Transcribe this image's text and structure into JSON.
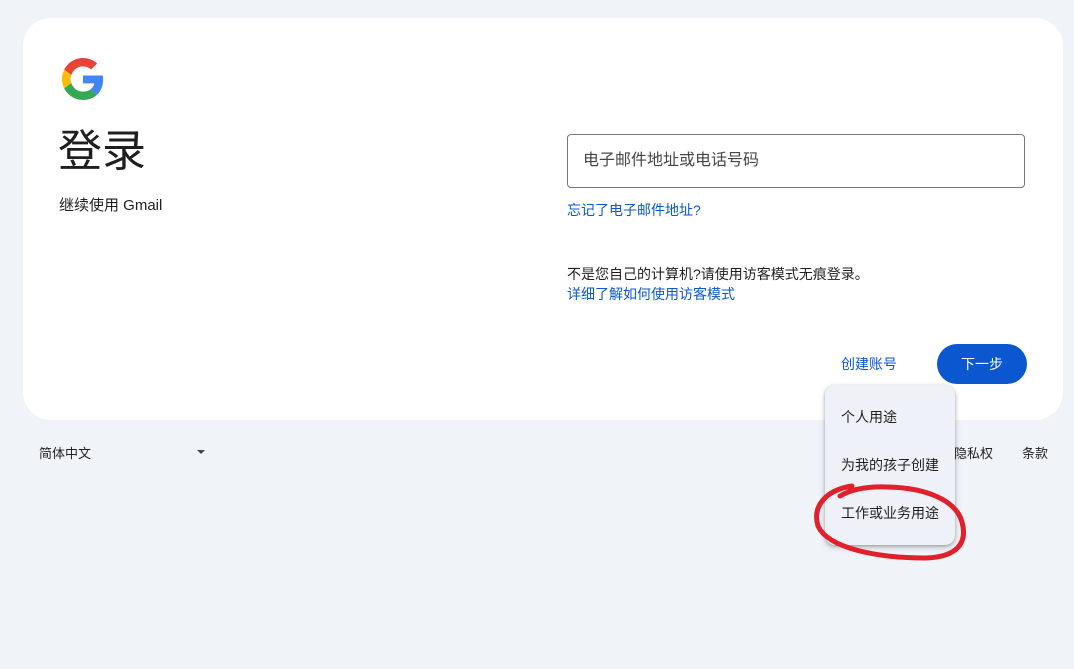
{
  "signin": {
    "heading": "登录",
    "subheading": "继续使用 Gmail"
  },
  "email": {
    "placeholder": "电子邮件地址或电话号码",
    "value": ""
  },
  "links": {
    "forgot_email": "忘记了电子邮件地址?",
    "guest_note": "不是您自己的计算机?请使用访客模式无痕登录。",
    "guest_learn_more": "详细了解如何使用访客模式"
  },
  "actions": {
    "create_account": "创建账号",
    "next": "下一步"
  },
  "create_menu": {
    "items": [
      "个人用途",
      "为我的孩子创建",
      "工作或业务用途"
    ]
  },
  "footer": {
    "language": "简体中文",
    "privacy": "隐私权",
    "terms": "条款"
  },
  "colors": {
    "accent": "#0b57d0",
    "annotation": "#e0202a",
    "page_background": "#f0f4f9"
  },
  "icons": {
    "logo": "google-g-logo",
    "dropdown": "caret-down-icon"
  }
}
